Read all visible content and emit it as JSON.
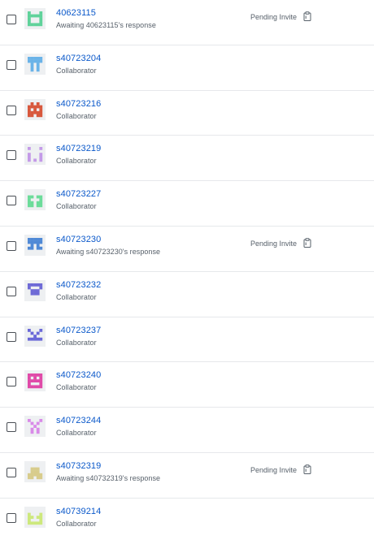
{
  "rows": [
    {
      "name": "40623115",
      "subtitle": "Awaiting 40623115's response",
      "status": "Pending Invite",
      "avatar_color": "#5fd29a",
      "pattern": [
        "10001",
        "11111",
        "10001",
        "10001",
        "11111"
      ]
    },
    {
      "name": "s40723204",
      "subtitle": "Collaborator",
      "status": "",
      "avatar_color": "#6ab3e8",
      "pattern": [
        "11111",
        "11111",
        "01010",
        "01010",
        "01010"
      ]
    },
    {
      "name": "s40723216",
      "subtitle": "Collaborator",
      "status": "",
      "avatar_color": "#d8583d",
      "pattern": [
        "01010",
        "11111",
        "10101",
        "11111",
        "11011"
      ]
    },
    {
      "name": "s40723219",
      "subtitle": "Collaborator",
      "status": "",
      "avatar_color": "#c49ae8",
      "pattern": [
        "10001",
        "00000",
        "10001",
        "10001",
        "10101"
      ]
    },
    {
      "name": "s40723227",
      "subtitle": "Collaborator",
      "status": "",
      "avatar_color": "#6cdc9a",
      "pattern": [
        "00000",
        "11011",
        "10001",
        "11011",
        "11011"
      ]
    },
    {
      "name": "s40723230",
      "subtitle": "Awaiting s40723230's response",
      "status": "Pending Invite",
      "avatar_color": "#4f89d6",
      "pattern": [
        "11111",
        "11111",
        "01010",
        "11011",
        "00000"
      ]
    },
    {
      "name": "s40723232",
      "subtitle": "Collaborator",
      "status": "",
      "avatar_color": "#6e6ad6",
      "pattern": [
        "11111",
        "10001",
        "01110",
        "01110",
        "00000"
      ]
    },
    {
      "name": "s40723237",
      "subtitle": "Collaborator",
      "status": "",
      "avatar_color": "#6a68d8",
      "pattern": [
        "10001",
        "01010",
        "00100",
        "11111",
        "00000"
      ]
    },
    {
      "name": "s40723240",
      "subtitle": "Collaborator",
      "status": "",
      "avatar_color": "#e04aa8",
      "pattern": [
        "11111",
        "10101",
        "11111",
        "10001",
        "11111"
      ]
    },
    {
      "name": "s40723244",
      "subtitle": "Collaborator",
      "status": "",
      "avatar_color": "#d98ae8",
      "pattern": [
        "10001",
        "01010",
        "00100",
        "01010",
        "01010"
      ]
    },
    {
      "name": "s40732319",
      "subtitle": "Awaiting s40732319's response",
      "status": "Pending Invite",
      "avatar_color": "#d8cc8c",
      "pattern": [
        "00000",
        "01110",
        "01110",
        "11111",
        "11011"
      ]
    },
    {
      "name": "s40739214",
      "subtitle": "Collaborator",
      "status": "",
      "avatar_color": "#cde87c",
      "pattern": [
        "00000",
        "10001",
        "11011",
        "10001",
        "11111"
      ]
    }
  ],
  "icons": {
    "row_select": "checkbox",
    "pending_copy": "clipboard-icon"
  }
}
